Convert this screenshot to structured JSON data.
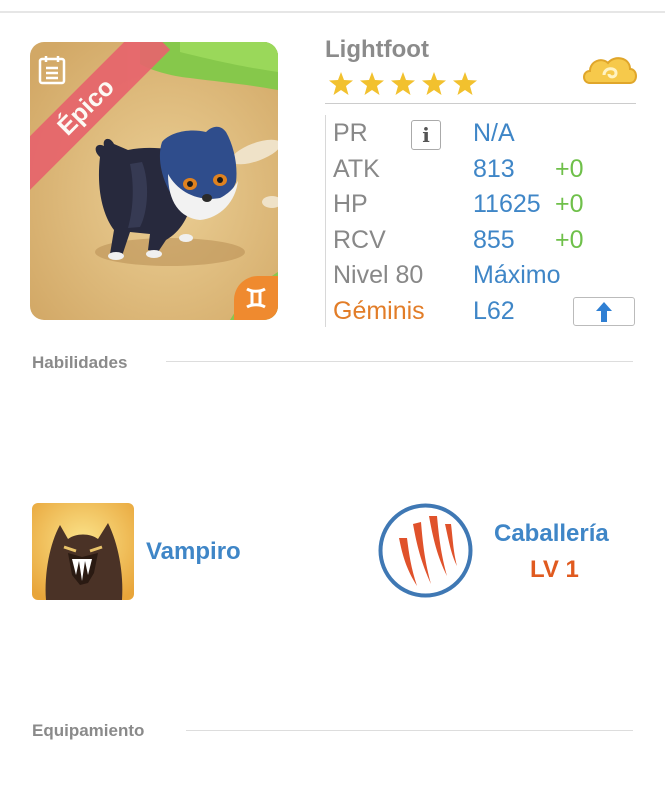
{
  "creature": {
    "name": "Lightfoot",
    "rarity": "Épico",
    "stars": 5,
    "zodiac_icon": "gemini-icon",
    "calendar_icon": "calendar-icon",
    "currency_icon": "cloud-coin-icon"
  },
  "stats": {
    "pr": {
      "label": "PR",
      "value": "N/A",
      "info_icon": "i"
    },
    "atk": {
      "label": "ATK",
      "value": "813",
      "bonus": "+0"
    },
    "hp": {
      "label": "HP",
      "value": "11625",
      "bonus": "+0"
    },
    "rcv": {
      "label": "RCV",
      "value": "855",
      "bonus": "+0"
    },
    "level": {
      "label": "Nivel 80",
      "value": "Máximo"
    },
    "sign": {
      "label": "Géminis",
      "value": "L62",
      "button_icon": "arrow-up-icon"
    }
  },
  "sections": {
    "skills_title": "Habilidades",
    "equipment_title": "Equipamiento"
  },
  "skills": {
    "active_name": "Vampiro",
    "passive_name": "Caballería",
    "passive_level": "LV 1"
  },
  "colors": {
    "accent_blue": "#3f86c7",
    "bonus_green": "#6fc04a",
    "sign_orange": "#e27d28",
    "level_red": "#e05a1f",
    "rarity_red": "#e7646c"
  }
}
